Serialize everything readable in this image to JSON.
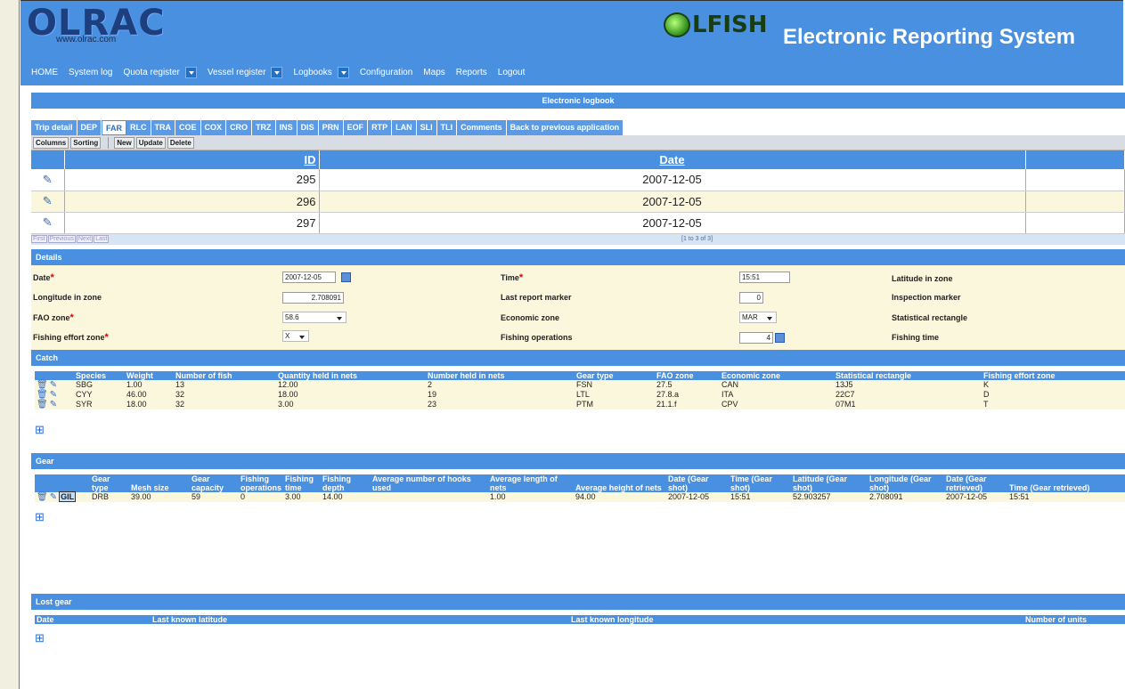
{
  "header": {
    "logo": "OLRAC",
    "logo_url": "www.olrac.com",
    "olfish": "LFISH",
    "title": "Electronic Reporting System"
  },
  "nav": [
    {
      "label": "HOME",
      "dropdown": false
    },
    {
      "label": "System log",
      "dropdown": false
    },
    {
      "label": "Quota register",
      "dropdown": true
    },
    {
      "label": "Vessel register",
      "dropdown": true
    },
    {
      "label": "Logbooks",
      "dropdown": true
    },
    {
      "label": "Configuration",
      "dropdown": false
    },
    {
      "label": "Maps",
      "dropdown": false
    },
    {
      "label": "Reports",
      "dropdown": false
    },
    {
      "label": "Logout",
      "dropdown": false
    }
  ],
  "logbook_title": "Electronic logbook",
  "tabs": [
    "Trip detail",
    "DEP",
    "FAR",
    "RLC",
    "TRA",
    "COE",
    "COX",
    "CRO",
    "TRZ",
    "INS",
    "DIS",
    "PRN",
    "EOF",
    "RTP",
    "LAN",
    "SLI",
    "TLI",
    "Comments",
    "Back to previous application"
  ],
  "active_tab": "FAR",
  "toolbar": {
    "columns": "Columns",
    "sorting": "Sorting",
    "new": "New",
    "update": "Update",
    "delete": "Delete"
  },
  "grid": {
    "headers": {
      "id": "ID",
      "date": "Date"
    },
    "rows": [
      {
        "id": "295",
        "date": "2007-12-05"
      },
      {
        "id": "296",
        "date": "2007-12-05"
      },
      {
        "id": "297",
        "date": "2007-12-05"
      }
    ]
  },
  "pager": {
    "first": "First",
    "previous": "Previous",
    "next": "Next",
    "last": "Last",
    "info": "[1 to 3 of 3]"
  },
  "details": {
    "title": "Details",
    "date_label": "Date",
    "date_value": "2007-12-05",
    "time_label": "Time",
    "time_value": "15:51",
    "lat_label": "Latitude in zone",
    "lon_label": "Longitude in zone",
    "lon_value": "2.708091",
    "last_report_label": "Last report marker",
    "last_report_value": "0",
    "inspection_label": "Inspection marker",
    "fao_label": "FAO zone",
    "fao_value": "58.6",
    "econ_label": "Economic zone",
    "econ_value": "MAR",
    "stat_rect_label": "Statistical rectangle",
    "effort_label": "Fishing effort zone",
    "effort_value": "X",
    "ops_label": "Fishing operations",
    "ops_value": "4",
    "fishing_time_label": "Fishing time"
  },
  "catch": {
    "title": "Catch",
    "headers": [
      "Species",
      "Weight",
      "Number of fish",
      "Quantity held in nets",
      "Number held in nets",
      "Gear type",
      "FAO zone",
      "Economic zone",
      "Statistical rectangle",
      "Fishing effort zone"
    ],
    "rows": [
      [
        "SBG",
        "1.00",
        "13",
        "12.00",
        "2",
        "FSN",
        "27.5",
        "CAN",
        "13J5",
        "K"
      ],
      [
        "CYY",
        "46.00",
        "32",
        "18.00",
        "19",
        "LTL",
        "27.8.a",
        "ITA",
        "22C7",
        "D"
      ],
      [
        "SYR",
        "18.00",
        "32",
        "3.00",
        "23",
        "PTM",
        "21.1.f",
        "CPV",
        "07M1",
        "T"
      ]
    ]
  },
  "gear": {
    "title": "Gear",
    "headers": [
      "Gear type",
      "Mesh size",
      "Gear capacity",
      "Fishing operations",
      "Fishing time",
      "Fishing depth",
      "Average number of hooks used",
      "Average length of nets",
      "Average height of nets",
      "Date (Gear shot)",
      "Time (Gear shot)",
      "Latitude (Gear shot)",
      "Longitude (Gear shot)",
      "Date (Gear retrieved)",
      "Time (Gear retrieved)"
    ],
    "gil_label": "GIL",
    "row": [
      "DRB",
      "39.00",
      "59",
      "0",
      "3.00",
      "14.00",
      "",
      "1.00",
      "94.00",
      "2007-12-05",
      "15:51",
      "52.903257",
      "2.708091",
      "2007-12-05",
      "15:51"
    ]
  },
  "lost_gear": {
    "title": "Lost gear",
    "headers": [
      "Date",
      "Last known latitude",
      "Last known longitude",
      "Number of units"
    ]
  }
}
